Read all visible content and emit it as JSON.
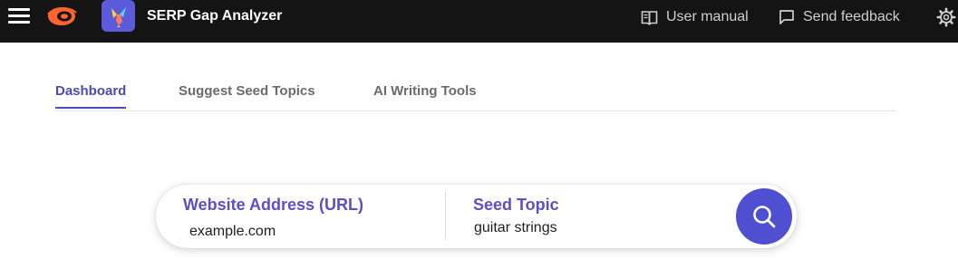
{
  "header": {
    "app_title": "SERP Gap Analyzer",
    "user_manual_label": "User manual",
    "send_feedback_label": "Send feedback",
    "bar_color": "#141414",
    "brand_color": "#ff642d",
    "app_logo_color": "#5b5bdc"
  },
  "tabs": [
    {
      "label": "Dashboard",
      "active": true
    },
    {
      "label": "Suggest Seed Topics",
      "active": false
    },
    {
      "label": "AI Writing Tools",
      "active": false
    }
  ],
  "search": {
    "url_label": "Website Address (URL)",
    "url_value": "example.com",
    "seed_label": "Seed Topic",
    "seed_value": "guitar strings",
    "accent_color": "#4f4fd1"
  },
  "icons": {
    "menu": "hamburger-menu-icon",
    "brand": "semrush-logo-icon",
    "app": "hummingbird-app-icon",
    "manual": "book-icon",
    "feedback": "comment-icon",
    "settings": "gear-icon",
    "search": "search-icon"
  }
}
